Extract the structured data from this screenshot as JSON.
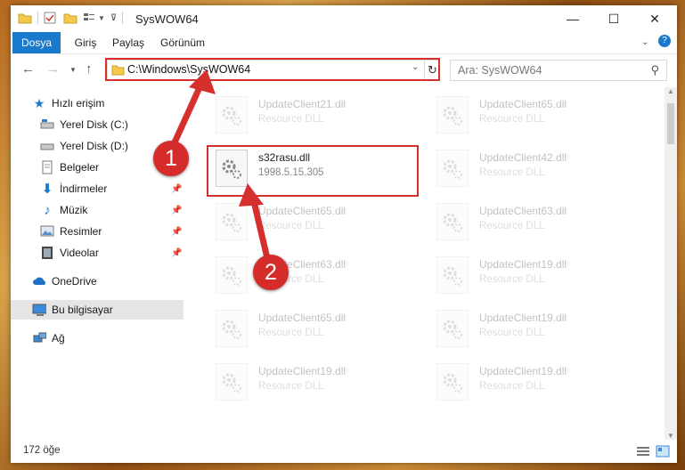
{
  "window": {
    "title": "SysWOW64"
  },
  "ribbon": {
    "tabs": [
      "Dosya",
      "Giriş",
      "Paylaş",
      "Görünüm"
    ]
  },
  "address": {
    "path": "C:\\Windows\\SysWOW64",
    "search_placeholder": "Ara: SysWOW64"
  },
  "sidebar": {
    "items": [
      {
        "label": "Hızlı erişim",
        "icon": "star-icon"
      },
      {
        "label": "Yerel Disk (C:)",
        "icon": "drive-icon"
      },
      {
        "label": "Yerel Disk (D:)",
        "icon": "drive-icon"
      },
      {
        "label": "Belgeler",
        "icon": "documents-icon"
      },
      {
        "label": "İndirmeler",
        "icon": "download-icon"
      },
      {
        "label": "Müzik",
        "icon": "music-icon"
      },
      {
        "label": "Resimler",
        "icon": "pictures-icon"
      },
      {
        "label": "Videolar",
        "icon": "videos-icon"
      },
      {
        "label": "OneDrive",
        "icon": "cloud-icon"
      },
      {
        "label": "Bu bilgisayar",
        "icon": "computer-icon"
      },
      {
        "label": "Ağ",
        "icon": "network-icon"
      }
    ]
  },
  "files": [
    {
      "name": "UpdateClient21.dll",
      "type": "Resource DLL"
    },
    {
      "name": "UpdateClient65.dll",
      "type": "Resource DLL"
    },
    {
      "name": "s32rasu.dll",
      "type": "1998.5.15.305"
    },
    {
      "name": "UpdateClient42.dll",
      "type": "Resource DLL"
    },
    {
      "name": "UpdateClient65.dll",
      "type": "Resource DLL"
    },
    {
      "name": "UpdateClient63.dll",
      "type": "Resource DLL"
    },
    {
      "name": "UpdateClient63.dll",
      "type": "Resource DLL"
    },
    {
      "name": "UpdateClient19.dll",
      "type": "Resource DLL"
    },
    {
      "name": "UpdateClient65.dll",
      "type": "Resource DLL"
    },
    {
      "name": "UpdateClient19.dll",
      "type": "Resource DLL"
    },
    {
      "name": "UpdateClient19.dll",
      "type": "Resource DLL"
    },
    {
      "name": "UpdateClient19.dll",
      "type": "Resource DLL"
    }
  ],
  "status": {
    "count": "172 öğe"
  },
  "annotations": {
    "badge1": "1",
    "badge2": "2",
    "color": "#d5302d"
  }
}
